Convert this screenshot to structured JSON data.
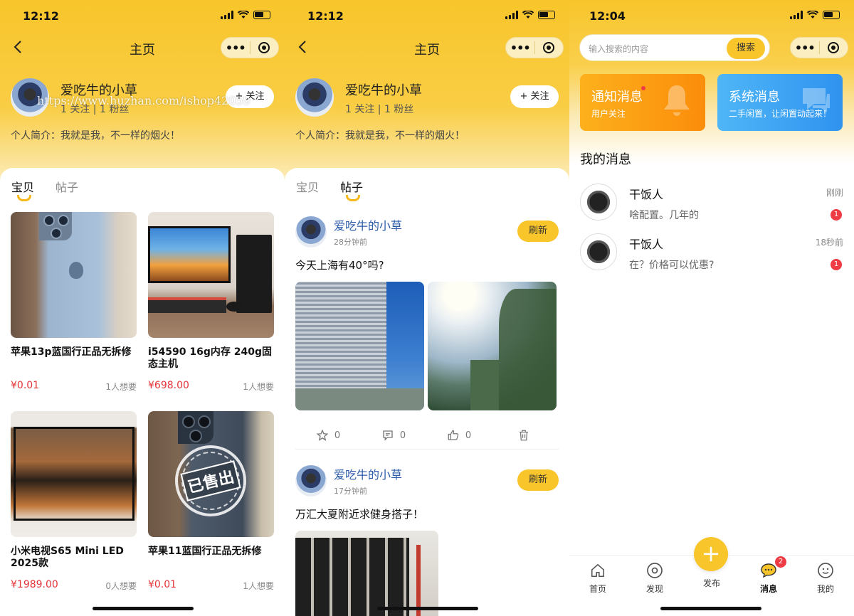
{
  "status": {
    "time1": "12:12",
    "time2": "12:12",
    "time3": "12:04"
  },
  "nav": {
    "title": "主页",
    "dots": "•••"
  },
  "profile": {
    "name": "爱吃牛的小草",
    "stats": "1 关注 | 1 粉丝",
    "follow_label": "+ 关注",
    "bio": "个人简介：我就是我，不一样的烟火！",
    "watermark": "https://www.huzhan.com/ishop42059"
  },
  "tabs": {
    "goods": "宝贝",
    "posts": "帖子"
  },
  "goods": [
    {
      "title": "苹果13p蓝国行正品无拆修",
      "price": "¥0.01",
      "want": "1人想要"
    },
    {
      "title": "i54590 16g内存 240g固态主机",
      "price": "¥698.00",
      "want": "1人想要"
    },
    {
      "title": "小米电视S65 Mini LED 2025款",
      "price": "¥1989.00",
      "want": "0人想要"
    },
    {
      "title": "苹果11蓝国行正品无拆修",
      "price": "¥0.01",
      "want": "1人想要",
      "stamp": "已售出"
    }
  ],
  "posts": [
    {
      "user": "爱吃牛的小草",
      "time": "28分钟前",
      "text": "今天上海有40°吗?",
      "refresh": "刷新",
      "likes": "0",
      "comments": "0",
      "thumbs": "0"
    },
    {
      "user": "爱吃牛的小草",
      "time": "17分钟前",
      "text": "万汇大夏附近求健身搭子！",
      "refresh": "刷新"
    }
  ],
  "search": {
    "placeholder": "输入搜索的内容",
    "button": "搜索"
  },
  "notices": [
    {
      "title": "通知消息",
      "sub": "用户关注",
      "color": "#fb9a0f"
    },
    {
      "title": "系统消息",
      "sub": "二手闲置，让闲置动起来！",
      "color": "#3aa3f5"
    }
  ],
  "messages_title": "我的消息",
  "messages": [
    {
      "name": "干饭人",
      "text": "啥配置。几年的",
      "time": "刚刚",
      "badge": "1"
    },
    {
      "name": "干饭人",
      "text": "在？价格可以优惠?",
      "time": "18秒前",
      "badge": "1"
    }
  ],
  "tabbar": {
    "home": "首页",
    "discover": "发现",
    "publish": "发布",
    "messages": "消息",
    "mine": "我的",
    "msg_badge": "2",
    "plus": "+"
  },
  "colors": {
    "brand": "#f8c52b",
    "price": "#e5333a",
    "link": "#2a5aa8"
  }
}
